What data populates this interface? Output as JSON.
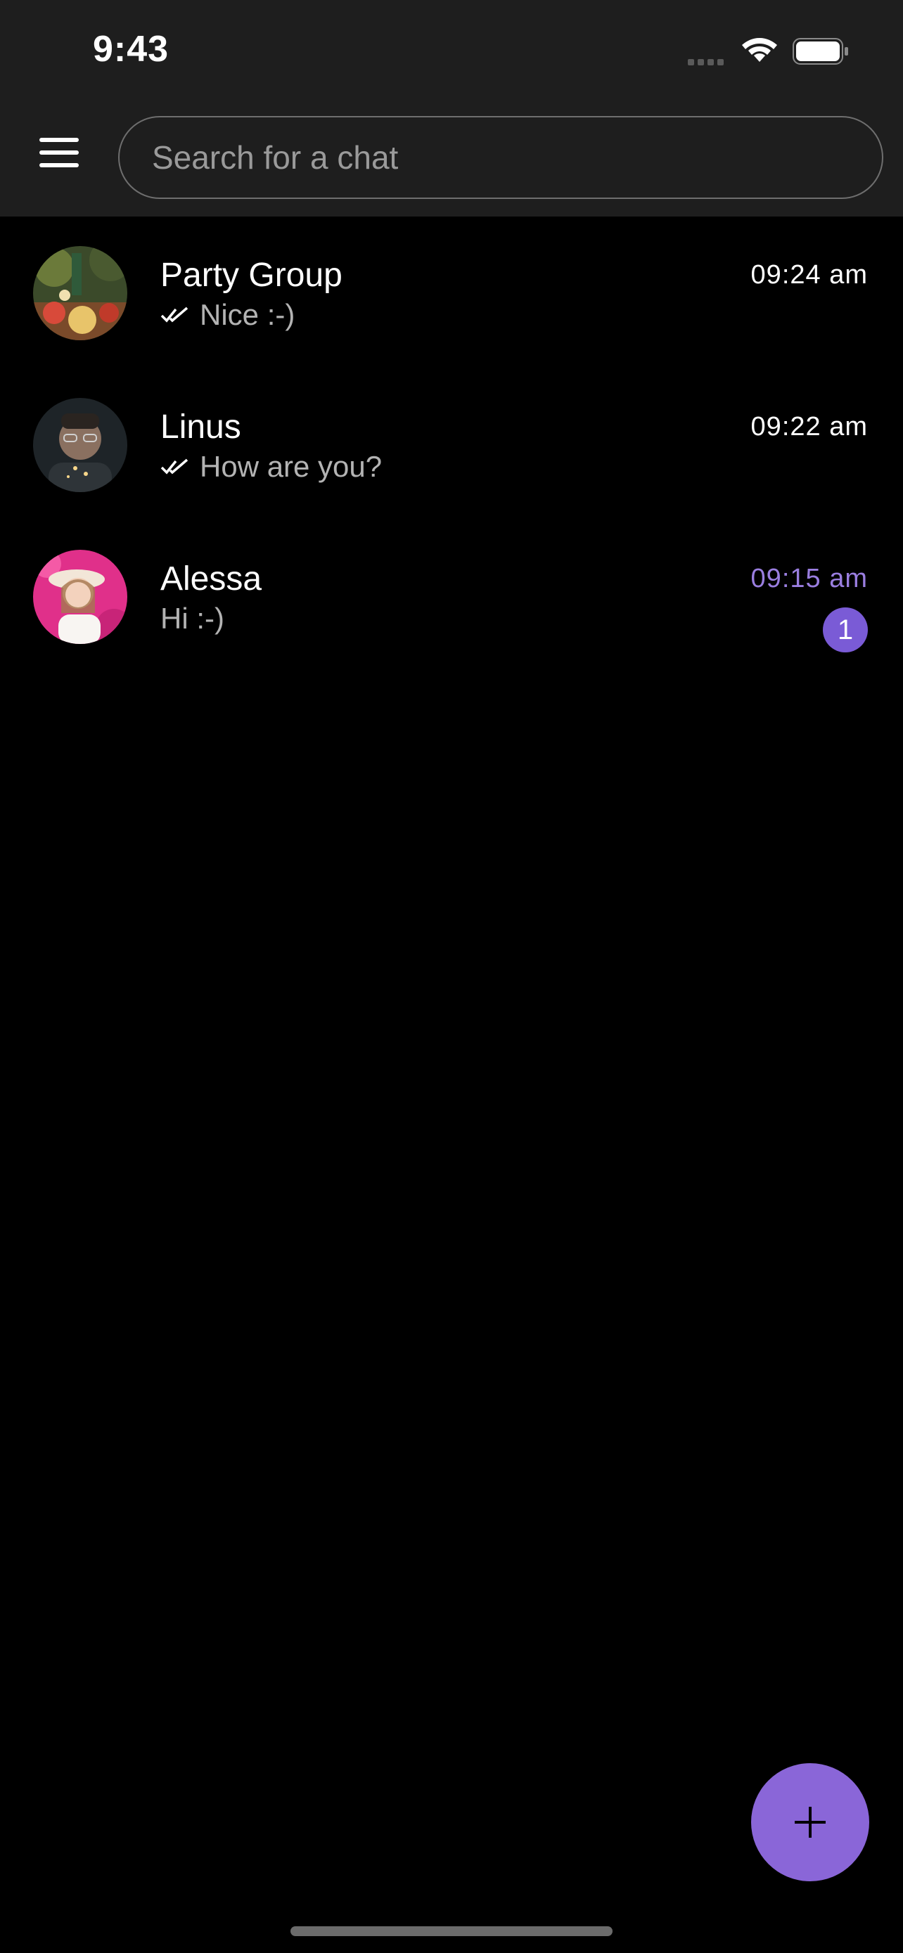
{
  "status_bar": {
    "time": "9:43"
  },
  "search": {
    "placeholder": "Search for a chat"
  },
  "chats": [
    {
      "name": "Party Group",
      "preview": "Nice :-)",
      "time": "09:24 am",
      "read": true,
      "unread_count": null
    },
    {
      "name": "Linus",
      "preview": "How are you?",
      "time": "09:22 am",
      "read": true,
      "unread_count": null
    },
    {
      "name": "Alessa",
      "preview": "Hi :-)",
      "time": "09:15 am",
      "read": false,
      "unread_count": "1"
    }
  ],
  "fab": {
    "icon": "plus-icon"
  },
  "colors": {
    "accent": "#8a66d8",
    "unread_time": "#9a7ee0",
    "topbar": "#1e1e1e"
  }
}
